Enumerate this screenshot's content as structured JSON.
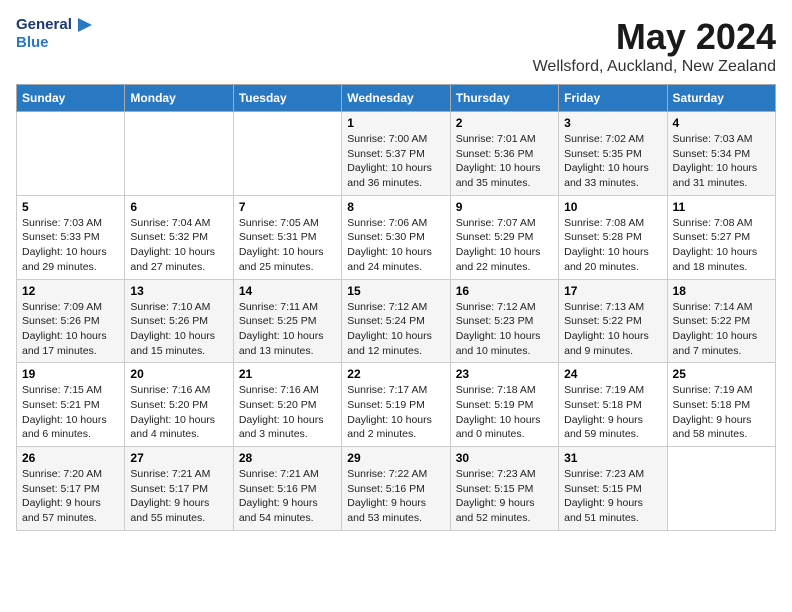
{
  "header": {
    "logo_line1": "General",
    "logo_line2": "Blue",
    "title": "May 2024",
    "subtitle": "Wellsford, Auckland, New Zealand"
  },
  "weekdays": [
    "Sunday",
    "Monday",
    "Tuesday",
    "Wednesday",
    "Thursday",
    "Friday",
    "Saturday"
  ],
  "weeks": [
    [
      {
        "day": "",
        "info": ""
      },
      {
        "day": "",
        "info": ""
      },
      {
        "day": "",
        "info": ""
      },
      {
        "day": "1",
        "info": "Sunrise: 7:00 AM\nSunset: 5:37 PM\nDaylight: 10 hours\nand 36 minutes."
      },
      {
        "day": "2",
        "info": "Sunrise: 7:01 AM\nSunset: 5:36 PM\nDaylight: 10 hours\nand 35 minutes."
      },
      {
        "day": "3",
        "info": "Sunrise: 7:02 AM\nSunset: 5:35 PM\nDaylight: 10 hours\nand 33 minutes."
      },
      {
        "day": "4",
        "info": "Sunrise: 7:03 AM\nSunset: 5:34 PM\nDaylight: 10 hours\nand 31 minutes."
      }
    ],
    [
      {
        "day": "5",
        "info": "Sunrise: 7:03 AM\nSunset: 5:33 PM\nDaylight: 10 hours\nand 29 minutes."
      },
      {
        "day": "6",
        "info": "Sunrise: 7:04 AM\nSunset: 5:32 PM\nDaylight: 10 hours\nand 27 minutes."
      },
      {
        "day": "7",
        "info": "Sunrise: 7:05 AM\nSunset: 5:31 PM\nDaylight: 10 hours\nand 25 minutes."
      },
      {
        "day": "8",
        "info": "Sunrise: 7:06 AM\nSunset: 5:30 PM\nDaylight: 10 hours\nand 24 minutes."
      },
      {
        "day": "9",
        "info": "Sunrise: 7:07 AM\nSunset: 5:29 PM\nDaylight: 10 hours\nand 22 minutes."
      },
      {
        "day": "10",
        "info": "Sunrise: 7:08 AM\nSunset: 5:28 PM\nDaylight: 10 hours\nand 20 minutes."
      },
      {
        "day": "11",
        "info": "Sunrise: 7:08 AM\nSunset: 5:27 PM\nDaylight: 10 hours\nand 18 minutes."
      }
    ],
    [
      {
        "day": "12",
        "info": "Sunrise: 7:09 AM\nSunset: 5:26 PM\nDaylight: 10 hours\nand 17 minutes."
      },
      {
        "day": "13",
        "info": "Sunrise: 7:10 AM\nSunset: 5:26 PM\nDaylight: 10 hours\nand 15 minutes."
      },
      {
        "day": "14",
        "info": "Sunrise: 7:11 AM\nSunset: 5:25 PM\nDaylight: 10 hours\nand 13 minutes."
      },
      {
        "day": "15",
        "info": "Sunrise: 7:12 AM\nSunset: 5:24 PM\nDaylight: 10 hours\nand 12 minutes."
      },
      {
        "day": "16",
        "info": "Sunrise: 7:12 AM\nSunset: 5:23 PM\nDaylight: 10 hours\nand 10 minutes."
      },
      {
        "day": "17",
        "info": "Sunrise: 7:13 AM\nSunset: 5:22 PM\nDaylight: 10 hours\nand 9 minutes."
      },
      {
        "day": "18",
        "info": "Sunrise: 7:14 AM\nSunset: 5:22 PM\nDaylight: 10 hours\nand 7 minutes."
      }
    ],
    [
      {
        "day": "19",
        "info": "Sunrise: 7:15 AM\nSunset: 5:21 PM\nDaylight: 10 hours\nand 6 minutes."
      },
      {
        "day": "20",
        "info": "Sunrise: 7:16 AM\nSunset: 5:20 PM\nDaylight: 10 hours\nand 4 minutes."
      },
      {
        "day": "21",
        "info": "Sunrise: 7:16 AM\nSunset: 5:20 PM\nDaylight: 10 hours\nand 3 minutes."
      },
      {
        "day": "22",
        "info": "Sunrise: 7:17 AM\nSunset: 5:19 PM\nDaylight: 10 hours\nand 2 minutes."
      },
      {
        "day": "23",
        "info": "Sunrise: 7:18 AM\nSunset: 5:19 PM\nDaylight: 10 hours\nand 0 minutes."
      },
      {
        "day": "24",
        "info": "Sunrise: 7:19 AM\nSunset: 5:18 PM\nDaylight: 9 hours\nand 59 minutes."
      },
      {
        "day": "25",
        "info": "Sunrise: 7:19 AM\nSunset: 5:18 PM\nDaylight: 9 hours\nand 58 minutes."
      }
    ],
    [
      {
        "day": "26",
        "info": "Sunrise: 7:20 AM\nSunset: 5:17 PM\nDaylight: 9 hours\nand 57 minutes."
      },
      {
        "day": "27",
        "info": "Sunrise: 7:21 AM\nSunset: 5:17 PM\nDaylight: 9 hours\nand 55 minutes."
      },
      {
        "day": "28",
        "info": "Sunrise: 7:21 AM\nSunset: 5:16 PM\nDaylight: 9 hours\nand 54 minutes."
      },
      {
        "day": "29",
        "info": "Sunrise: 7:22 AM\nSunset: 5:16 PM\nDaylight: 9 hours\nand 53 minutes."
      },
      {
        "day": "30",
        "info": "Sunrise: 7:23 AM\nSunset: 5:15 PM\nDaylight: 9 hours\nand 52 minutes."
      },
      {
        "day": "31",
        "info": "Sunrise: 7:23 AM\nSunset: 5:15 PM\nDaylight: 9 hours\nand 51 minutes."
      },
      {
        "day": "",
        "info": ""
      }
    ]
  ]
}
